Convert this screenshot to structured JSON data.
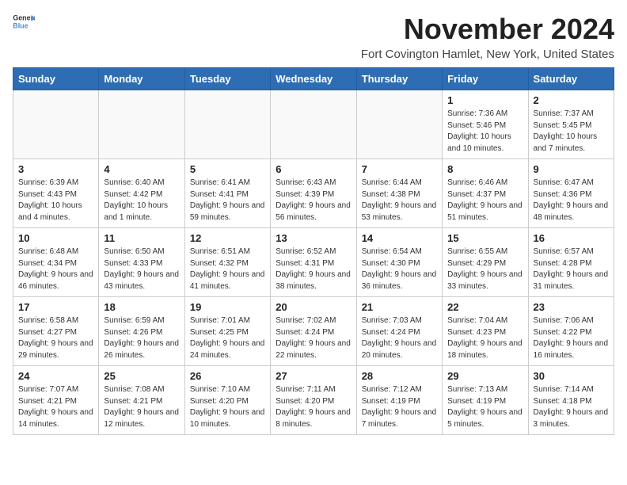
{
  "logo": {
    "general": "General",
    "blue": "Blue"
  },
  "title": "November 2024",
  "location": "Fort Covington Hamlet, New York, United States",
  "days_of_week": [
    "Sunday",
    "Monday",
    "Tuesday",
    "Wednesday",
    "Thursday",
    "Friday",
    "Saturday"
  ],
  "weeks": [
    [
      {
        "day": "",
        "info": ""
      },
      {
        "day": "",
        "info": ""
      },
      {
        "day": "",
        "info": ""
      },
      {
        "day": "",
        "info": ""
      },
      {
        "day": "",
        "info": ""
      },
      {
        "day": "1",
        "info": "Sunrise: 7:36 AM\nSunset: 5:46 PM\nDaylight: 10 hours and 10 minutes."
      },
      {
        "day": "2",
        "info": "Sunrise: 7:37 AM\nSunset: 5:45 PM\nDaylight: 10 hours and 7 minutes."
      }
    ],
    [
      {
        "day": "3",
        "info": "Sunrise: 6:39 AM\nSunset: 4:43 PM\nDaylight: 10 hours and 4 minutes."
      },
      {
        "day": "4",
        "info": "Sunrise: 6:40 AM\nSunset: 4:42 PM\nDaylight: 10 hours and 1 minute."
      },
      {
        "day": "5",
        "info": "Sunrise: 6:41 AM\nSunset: 4:41 PM\nDaylight: 9 hours and 59 minutes."
      },
      {
        "day": "6",
        "info": "Sunrise: 6:43 AM\nSunset: 4:39 PM\nDaylight: 9 hours and 56 minutes."
      },
      {
        "day": "7",
        "info": "Sunrise: 6:44 AM\nSunset: 4:38 PM\nDaylight: 9 hours and 53 minutes."
      },
      {
        "day": "8",
        "info": "Sunrise: 6:46 AM\nSunset: 4:37 PM\nDaylight: 9 hours and 51 minutes."
      },
      {
        "day": "9",
        "info": "Sunrise: 6:47 AM\nSunset: 4:36 PM\nDaylight: 9 hours and 48 minutes."
      }
    ],
    [
      {
        "day": "10",
        "info": "Sunrise: 6:48 AM\nSunset: 4:34 PM\nDaylight: 9 hours and 46 minutes."
      },
      {
        "day": "11",
        "info": "Sunrise: 6:50 AM\nSunset: 4:33 PM\nDaylight: 9 hours and 43 minutes."
      },
      {
        "day": "12",
        "info": "Sunrise: 6:51 AM\nSunset: 4:32 PM\nDaylight: 9 hours and 41 minutes."
      },
      {
        "day": "13",
        "info": "Sunrise: 6:52 AM\nSunset: 4:31 PM\nDaylight: 9 hours and 38 minutes."
      },
      {
        "day": "14",
        "info": "Sunrise: 6:54 AM\nSunset: 4:30 PM\nDaylight: 9 hours and 36 minutes."
      },
      {
        "day": "15",
        "info": "Sunrise: 6:55 AM\nSunset: 4:29 PM\nDaylight: 9 hours and 33 minutes."
      },
      {
        "day": "16",
        "info": "Sunrise: 6:57 AM\nSunset: 4:28 PM\nDaylight: 9 hours and 31 minutes."
      }
    ],
    [
      {
        "day": "17",
        "info": "Sunrise: 6:58 AM\nSunset: 4:27 PM\nDaylight: 9 hours and 29 minutes."
      },
      {
        "day": "18",
        "info": "Sunrise: 6:59 AM\nSunset: 4:26 PM\nDaylight: 9 hours and 26 minutes."
      },
      {
        "day": "19",
        "info": "Sunrise: 7:01 AM\nSunset: 4:25 PM\nDaylight: 9 hours and 24 minutes."
      },
      {
        "day": "20",
        "info": "Sunrise: 7:02 AM\nSunset: 4:24 PM\nDaylight: 9 hours and 22 minutes."
      },
      {
        "day": "21",
        "info": "Sunrise: 7:03 AM\nSunset: 4:24 PM\nDaylight: 9 hours and 20 minutes."
      },
      {
        "day": "22",
        "info": "Sunrise: 7:04 AM\nSunset: 4:23 PM\nDaylight: 9 hours and 18 minutes."
      },
      {
        "day": "23",
        "info": "Sunrise: 7:06 AM\nSunset: 4:22 PM\nDaylight: 9 hours and 16 minutes."
      }
    ],
    [
      {
        "day": "24",
        "info": "Sunrise: 7:07 AM\nSunset: 4:21 PM\nDaylight: 9 hours and 14 minutes."
      },
      {
        "day": "25",
        "info": "Sunrise: 7:08 AM\nSunset: 4:21 PM\nDaylight: 9 hours and 12 minutes."
      },
      {
        "day": "26",
        "info": "Sunrise: 7:10 AM\nSunset: 4:20 PM\nDaylight: 9 hours and 10 minutes."
      },
      {
        "day": "27",
        "info": "Sunrise: 7:11 AM\nSunset: 4:20 PM\nDaylight: 9 hours and 8 minutes."
      },
      {
        "day": "28",
        "info": "Sunrise: 7:12 AM\nSunset: 4:19 PM\nDaylight: 9 hours and 7 minutes."
      },
      {
        "day": "29",
        "info": "Sunrise: 7:13 AM\nSunset: 4:19 PM\nDaylight: 9 hours and 5 minutes."
      },
      {
        "day": "30",
        "info": "Sunrise: 7:14 AM\nSunset: 4:18 PM\nDaylight: 9 hours and 3 minutes."
      }
    ]
  ]
}
